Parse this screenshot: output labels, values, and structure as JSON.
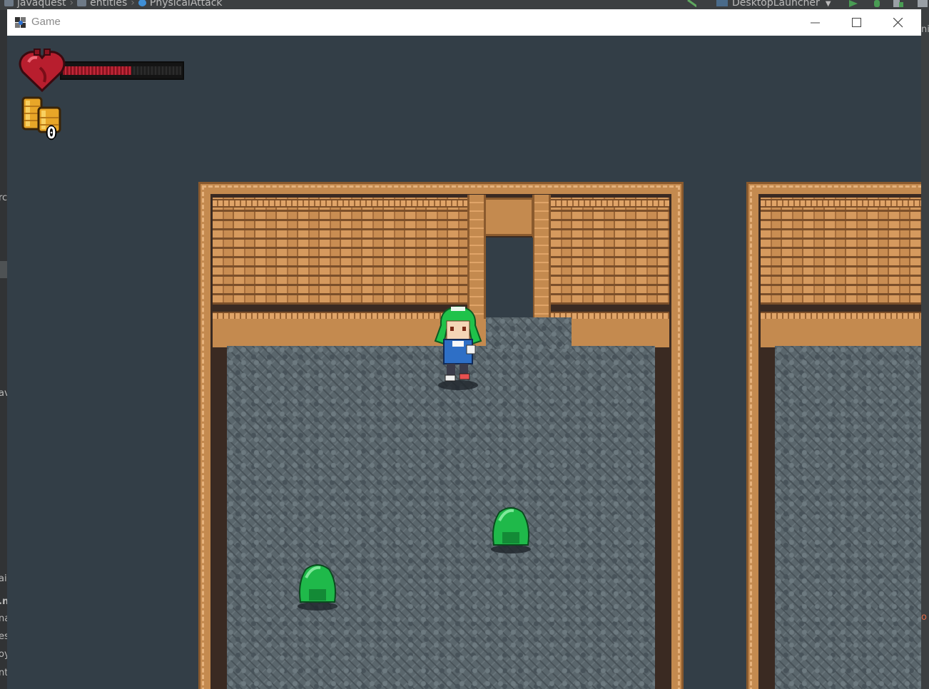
{
  "ide": {
    "breadcrumbs": [
      "javaquest",
      "entities",
      "PhysicalAttack"
    ],
    "run_config": "DesktopLauncher",
    "left_fragments": [
      "rc",
      "av",
      "ai",
      ".n",
      "na",
      "ess",
      "oy",
      "nt"
    ],
    "right_fragments": [
      "ni",
      "o"
    ]
  },
  "window": {
    "title": "Game",
    "controls": {
      "minimize": "minimize",
      "maximize": "maximize",
      "close": "close"
    }
  },
  "hud": {
    "health": {
      "current": 0.58,
      "icon": "heart-icon"
    },
    "coins": {
      "count": "0",
      "icon": "coin-stack-icon"
    }
  },
  "scene": {
    "player": {
      "name": "player-character",
      "hair_color": "#1fc24a"
    },
    "enemies": [
      {
        "name": "green-slime",
        "color": "#1fb94a"
      },
      {
        "name": "green-slime",
        "color": "#1fb94a"
      }
    ],
    "colors": {
      "background": "#333e47",
      "wall": "#b8804a",
      "floor": "#5a666c",
      "health_fill": "#c4283a"
    }
  }
}
